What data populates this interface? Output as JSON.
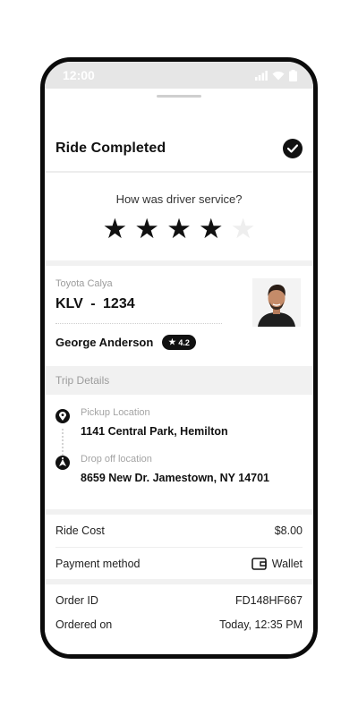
{
  "status_bar": {
    "time": "12:00"
  },
  "header": {
    "title": "Ride Completed"
  },
  "rating": {
    "question": "How was driver service?",
    "stars_filled": 4,
    "stars_total": 5
  },
  "driver": {
    "car_model": "Toyota Calya",
    "plate": "KLV - 1234",
    "name": "George Anderson",
    "rating": "4.2"
  },
  "trip": {
    "section_title": "Trip Details",
    "pickup_label": "Pickup Location",
    "pickup_address": "1141 Central Park, Hemilton",
    "dropoff_label": "Drop off location",
    "dropoff_address": "8659 New Dr. Jamestown, NY 14701"
  },
  "payment": {
    "ride_cost_label": "Ride Cost",
    "ride_cost_value": "$8.00",
    "method_label": "Payment method",
    "method_value": "Wallet"
  },
  "order": {
    "id_label": "Order ID",
    "id_value": "FD148HF667",
    "ordered_on_label": "Ordered on",
    "ordered_on_value": "Today, 12:35 PM"
  },
  "colors": {
    "accent": "#111111",
    "muted_text": "#9c9c9c",
    "section_bg": "#f1f1f1"
  }
}
